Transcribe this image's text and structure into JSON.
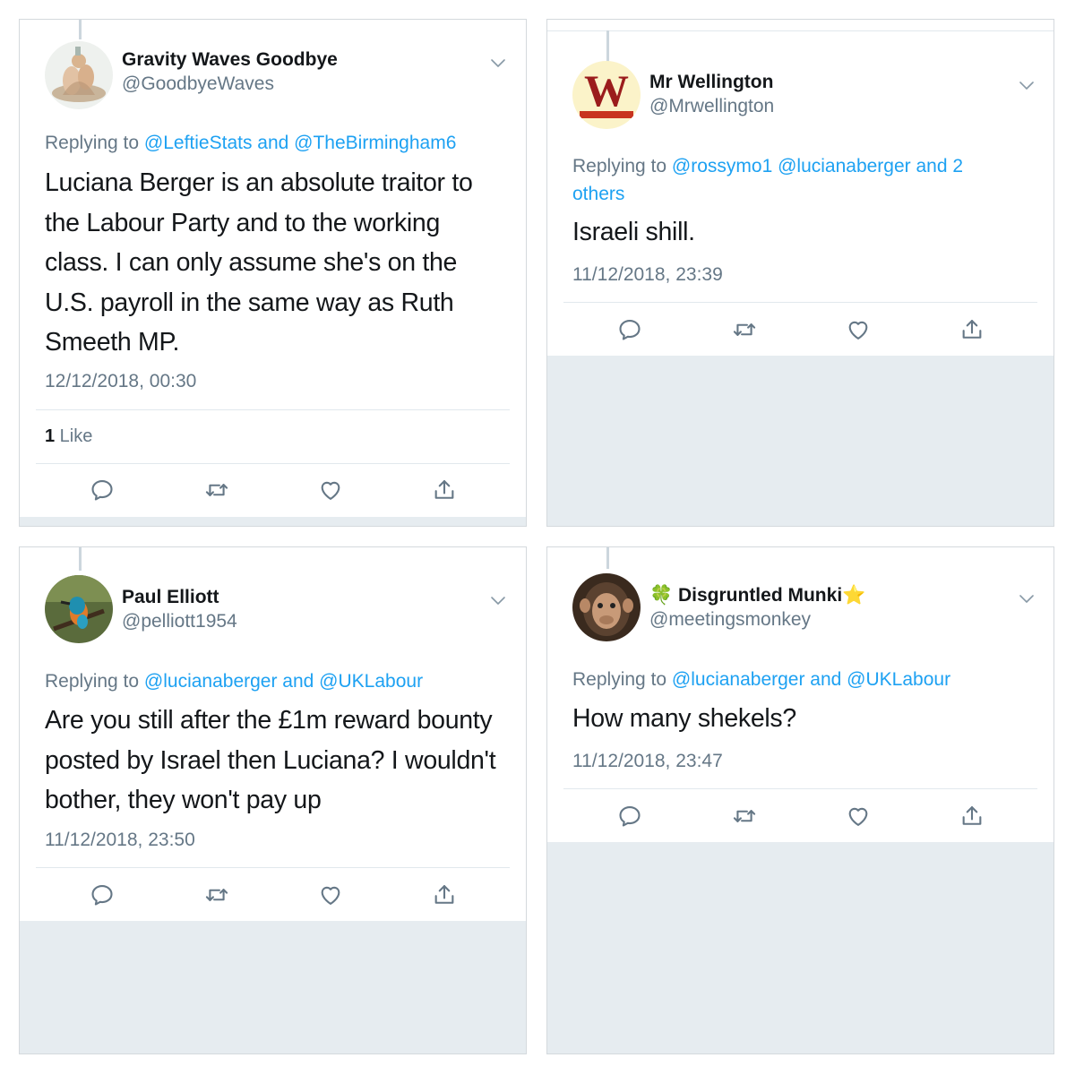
{
  "tweets": [
    {
      "name": "Gravity Waves Goodbye",
      "handle": "@GoodbyeWaves",
      "replying_prefix": "Replying to ",
      "replying_mentions": "@LeftieStats and @TheBirmingham6",
      "replying_mentions_2": "",
      "text": "Luciana Berger is an absolute traitor to the Labour Party and to the working class. I can only assume she's on the U.S. payroll in the same way as Ruth Smeeth MP.",
      "timestamp": "12/12/2018, 00:30",
      "likes_count": "1",
      "likes_label": " Like"
    },
    {
      "name": "Mr Wellington",
      "handle": "@Mrwellington",
      "replying_prefix": "Replying to ",
      "replying_mentions": "@rossymo1 @lucianaberger and 2",
      "replying_mentions_2": "others",
      "text": "Israeli shill.",
      "timestamp": "11/12/2018, 23:39",
      "likes_count": "",
      "likes_label": ""
    },
    {
      "name": "Paul Elliott",
      "handle": "@pelliott1954",
      "replying_prefix": "Replying to ",
      "replying_mentions": "@lucianaberger and @UKLabour",
      "replying_mentions_2": "",
      "text": "Are you still after the £1m reward bounty posted by Israel then Luciana? I wouldn't bother, they won't pay up",
      "timestamp": "11/12/2018, 23:50",
      "likes_count": "",
      "likes_label": ""
    },
    {
      "name": "🍀 Disgruntled Munki⭐",
      "handle": "@meetingsmonkey",
      "replying_prefix": "Replying to ",
      "replying_mentions": "@lucianaberger and @UKLabour",
      "replying_mentions_2": "",
      "text": "How many shekels?",
      "timestamp": "11/12/2018, 23:47",
      "likes_count": "",
      "likes_label": ""
    }
  ],
  "avatar_logo_letter": "W",
  "colors": {
    "link": "#1da1f2",
    "secondary": "#657786",
    "background": "#e6ecf0"
  },
  "icons": [
    "reply-icon",
    "retweet-icon",
    "like-icon",
    "share-icon",
    "chevron-down-icon"
  ]
}
